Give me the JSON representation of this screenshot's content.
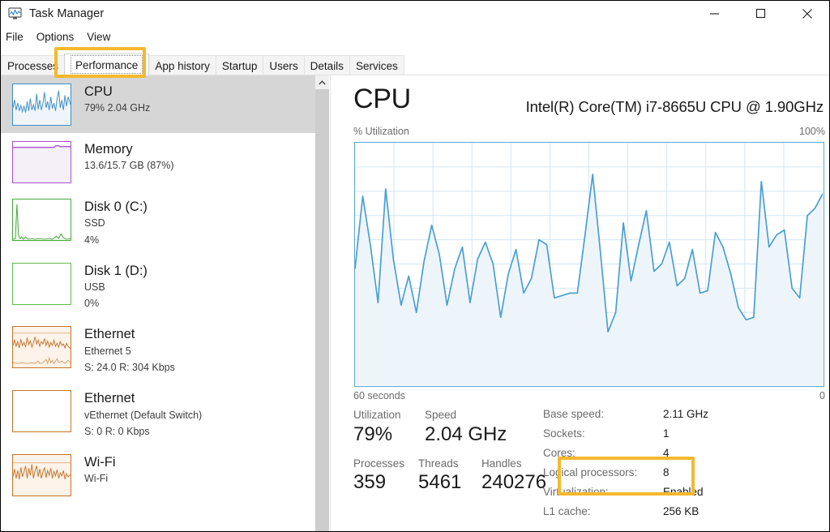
{
  "window": {
    "title": "Task Manager",
    "icon": "task-manager-icon",
    "minimize_label": "Minimize",
    "maximize_label": "Maximize",
    "close_label": "Close"
  },
  "menu": {
    "items": [
      {
        "label": "File"
      },
      {
        "label": "Options"
      },
      {
        "label": "View"
      }
    ]
  },
  "tabs": {
    "selected": "Performance",
    "items": [
      {
        "label": "Processes"
      },
      {
        "label": "Performance"
      },
      {
        "label": "App history"
      },
      {
        "label": "Startup"
      },
      {
        "label": "Users"
      },
      {
        "label": "Details"
      },
      {
        "label": "Services"
      }
    ]
  },
  "sidebar": {
    "scroll_up_icon": "chevron-up-icon",
    "items": [
      {
        "name": "CPU",
        "line1": "79%  2.04 GHz",
        "line2": "",
        "active": true,
        "accent": "#3e8fc4",
        "fill": "#eff5fa",
        "thumb": "cpu-sparkline"
      },
      {
        "name": "Memory",
        "line1": "13.6/15.7 GB (87%)",
        "line2": "",
        "active": false,
        "accent": "#ad4fce",
        "fill": "#f5f0f7",
        "thumb": "memory-sparkline"
      },
      {
        "name": "Disk 0 (C:)",
        "line1": "SSD",
        "line2": "4%",
        "active": false,
        "accent": "#4aa83c",
        "fill": "#f2f8f1",
        "thumb": "disk0-sparkline"
      },
      {
        "name": "Disk 1 (D:)",
        "line1": "USB",
        "line2": "0%",
        "active": false,
        "accent": "#63b94f",
        "fill": "#ffffff",
        "thumb": "disk1-sparkline"
      },
      {
        "name": "Ethernet",
        "line1": "Ethernet 5",
        "line2": "S: 24.0 R: 304 Kbps",
        "active": false,
        "accent": "#c4762c",
        "fill": "#fdf3ea",
        "thumb": "ethernet5-sparkline"
      },
      {
        "name": "Ethernet",
        "line1": "vEthernet (Default Switch)",
        "line2": "S: 0 R: 0 Kbps",
        "active": false,
        "accent": "#c4762c",
        "fill": "#ffffff",
        "thumb": "vethernet-sparkline"
      },
      {
        "name": "Wi-Fi",
        "line1": "Wi-Fi",
        "line2": "",
        "active": false,
        "accent": "#c4762c",
        "fill": "#fdf3ea",
        "thumb": "wifi-sparkline"
      }
    ]
  },
  "detail": {
    "title": "CPU",
    "subtitle": "Intel(R) Core(TM) i7-8665U CPU @ 1.90GHz",
    "graph_axis_label": "% Utilization",
    "graph_max": "100%",
    "graph_timespan": "60 seconds",
    "graph_min": "0",
    "stats": [
      {
        "label": "Utilization",
        "value": "79%"
      },
      {
        "label": "Speed",
        "value": "2.04 GHz"
      },
      {
        "label": "Processes",
        "value": "359"
      },
      {
        "label": "Threads",
        "value": "5461"
      },
      {
        "label": "Handles",
        "value": "240276"
      }
    ],
    "specs": [
      {
        "label": "Base speed:",
        "value": "2.11 GHz"
      },
      {
        "label": "Sockets:",
        "value": "1"
      },
      {
        "label": "Cores:",
        "value": "4"
      },
      {
        "label": "Logical processors:",
        "value": "8"
      },
      {
        "label": "Virtualization:",
        "value": "Enabled"
      },
      {
        "label": "L1 cache:",
        "value": "256 KB"
      }
    ]
  },
  "annotations": {
    "color": "#f5b82e",
    "boxes": [
      {
        "name": "performance-tab-highlight"
      },
      {
        "name": "cores-logical-processors-highlight"
      }
    ]
  },
  "chart_data": {
    "type": "area",
    "title": "% Utilization",
    "xlabel": "60 seconds",
    "ylabel": "% Utilization",
    "ylim": [
      0,
      100
    ],
    "xlim": [
      0,
      60
    ],
    "grid": true,
    "legend": false,
    "series_color": "#4a9fd4",
    "fill_color": "#eef5fa",
    "series": [
      {
        "name": "CPU utilization",
        "values": [
          48,
          78,
          58,
          34,
          81,
          52,
          33,
          45,
          30,
          51,
          66,
          54,
          33,
          48,
          57,
          34,
          52,
          59,
          50,
          28,
          46,
          56,
          38,
          44,
          60,
          58,
          36,
          37,
          38,
          38,
          62,
          87,
          55,
          22,
          30,
          67,
          43,
          58,
          72,
          47,
          50,
          59,
          41,
          44,
          56,
          38,
          39,
          63,
          57,
          46,
          32,
          27,
          28,
          84,
          57,
          62,
          64,
          40,
          36,
          70,
          73,
          79
        ]
      }
    ]
  }
}
